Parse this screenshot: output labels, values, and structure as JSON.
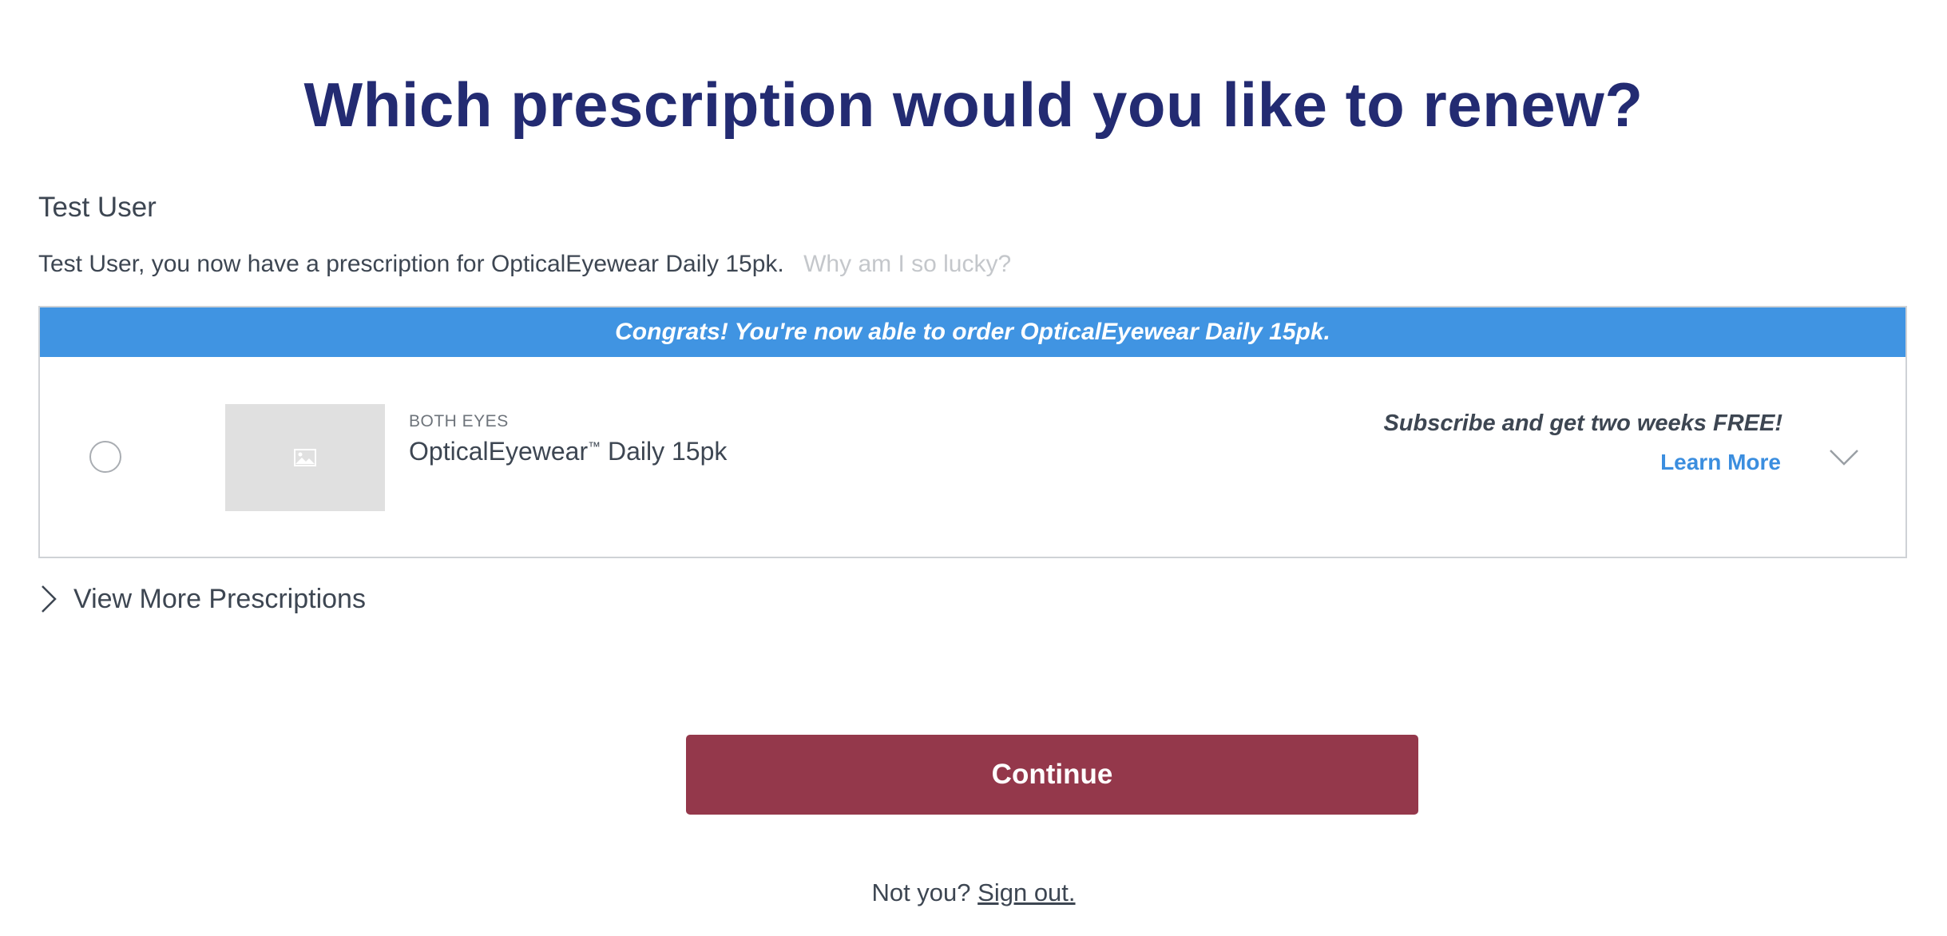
{
  "page_title": "Which prescription would you like to renew?",
  "user": {
    "name": "Test User",
    "info_text": "Test User, you now have a prescription for OpticalEyewear Daily 15pk.",
    "why_link": "Why am I so lucky?"
  },
  "prescription_card": {
    "banner": "Congrats! You're now able to order OpticalEyewear Daily 15pk.",
    "eye_label": "BOTH EYES",
    "product_name": "OpticalEyewear",
    "trademark": "™",
    "product_suffix": " Daily 15pk",
    "promo": "Subscribe and get two weeks FREE!",
    "learn_more": "Learn More",
    "selected": false
  },
  "view_more": "View More Prescriptions",
  "continue_label": "Continue",
  "footer": {
    "prompt": "Not you?",
    "sign_out": "Sign out."
  },
  "colors": {
    "title": "#232b72",
    "banner": "#4094e2",
    "link": "#3b8edf",
    "continue_button": "#94384b"
  },
  "icons": {
    "thumbnail": "image-placeholder-icon",
    "expand": "chevron-down-icon",
    "view_more": "chevron-right-icon"
  }
}
